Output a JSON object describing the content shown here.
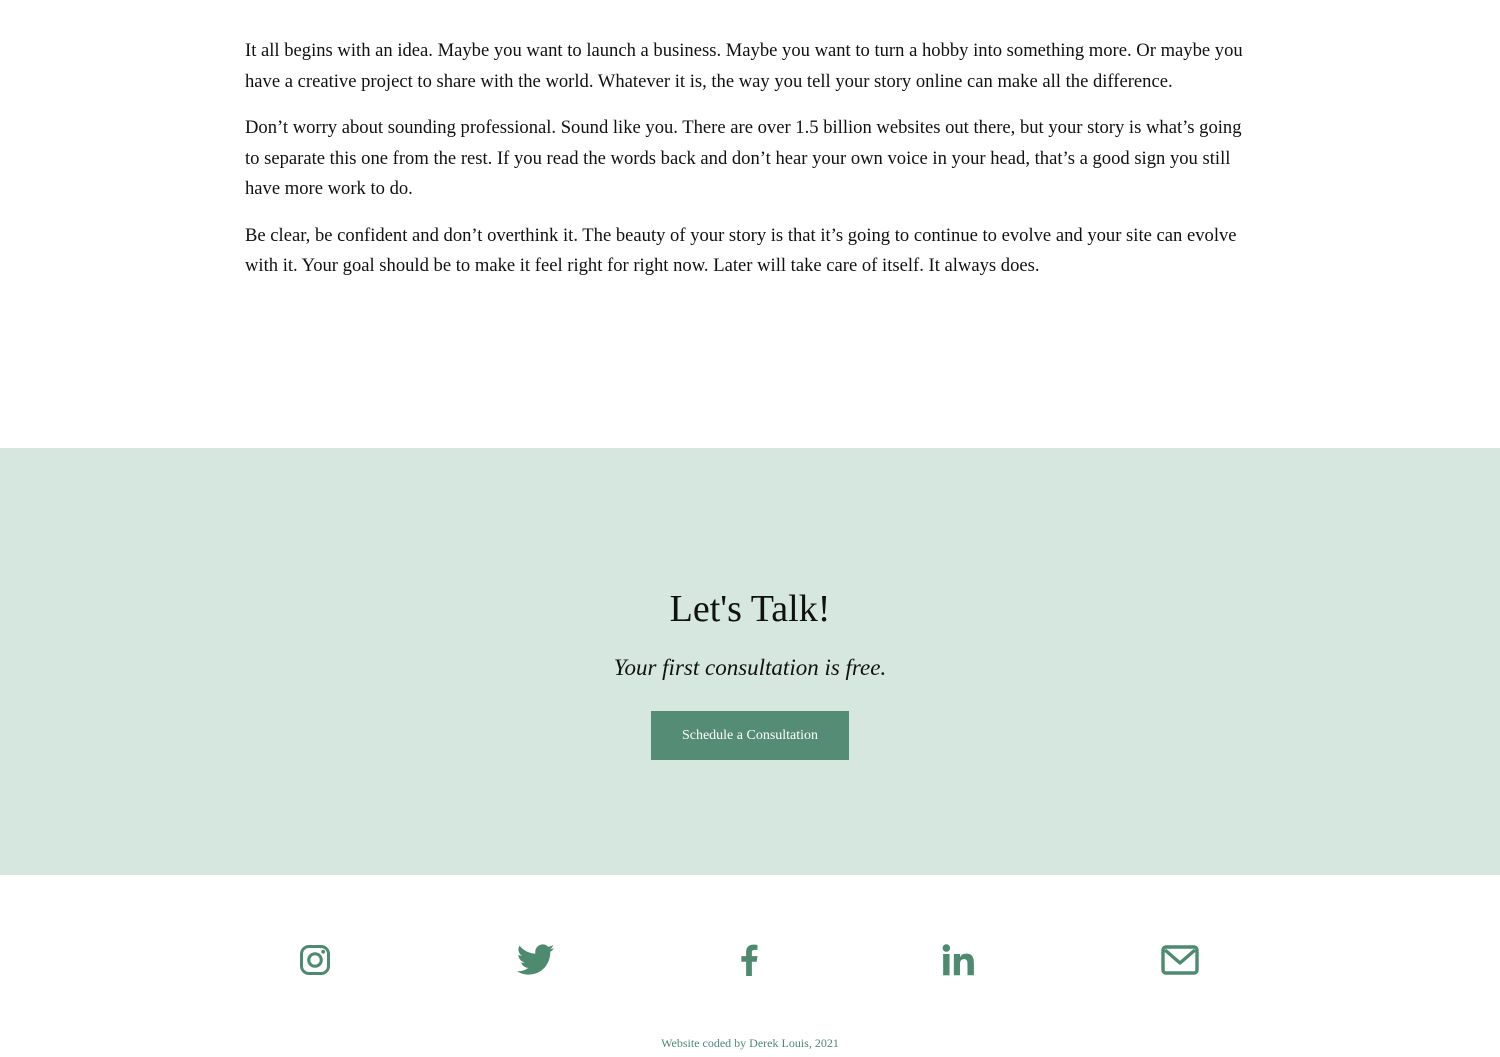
{
  "content": {
    "paragraphs": [
      "It all begins with an idea. Maybe you want to launch a business. Maybe you want to turn a hobby into something more. Or maybe you have a creative project to share with the world. Whatever it is, the way you tell your story online can make all the difference.",
      "Don’t worry about sounding professional. Sound like you. There are over 1.5 billion websites out there, but your story is what’s going to separate this one from the rest. If you read the words back and don’t hear your own voice in your head, that’s a good sign you still have more work to do.",
      "Be clear, be confident and don’t overthink it. The beauty of your story is that it’s going to continue to evolve and your site can evolve with it. Your goal should be to make it feel right for right now. Later will take care of itself. It always does."
    ]
  },
  "cta": {
    "title": "Let's Talk!",
    "subtitle": "Your first consultation is free.",
    "button_label": "Schedule a Consultation",
    "background_color": "#d6e7df",
    "button_color": "#558c75"
  },
  "social": {
    "icon_color": "#4e8a70",
    "icons": [
      "instagram-icon",
      "twitter-icon",
      "facebook-icon",
      "linkedin-icon",
      "email-icon"
    ]
  },
  "footer": {
    "credit": "Website coded by Derek Louis, 2021"
  }
}
